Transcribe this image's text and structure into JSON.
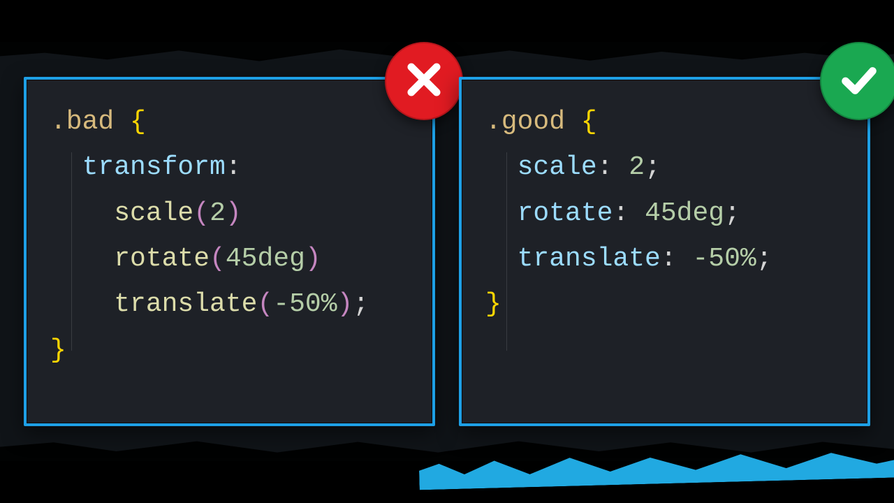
{
  "colors": {
    "border": "#1ea0e6",
    "panel": "#1e2127",
    "bad_badge": "#e11b22",
    "good_badge": "#1aa851",
    "blue_streak": "#21a9e1"
  },
  "bad": {
    "selector": ".bad",
    "open_brace": "{",
    "close_brace": "}",
    "property": "transform",
    "colon": ":",
    "semicolon": ";",
    "funcs": {
      "scale": {
        "name": "scale",
        "open": "(",
        "arg": "2",
        "unit": "",
        "close": ")"
      },
      "rotate": {
        "name": "rotate",
        "open": "(",
        "arg": "45",
        "unit": "deg",
        "close": ")"
      },
      "translate": {
        "name": "translate",
        "open": "(",
        "arg": "-50",
        "unit": "%",
        "close": ")"
      }
    }
  },
  "good": {
    "selector": ".good",
    "open_brace": "{",
    "close_brace": "}",
    "colon": ":",
    "semicolon": ";",
    "decls": {
      "scale": {
        "prop": "scale",
        "value": "2",
        "unit": ""
      },
      "rotate": {
        "prop": "rotate",
        "value": "45",
        "unit": "deg"
      },
      "translate": {
        "prop": "translate",
        "value": "-50",
        "unit": "%"
      }
    }
  },
  "badges": {
    "bad": "cross-icon",
    "good": "check-icon"
  }
}
